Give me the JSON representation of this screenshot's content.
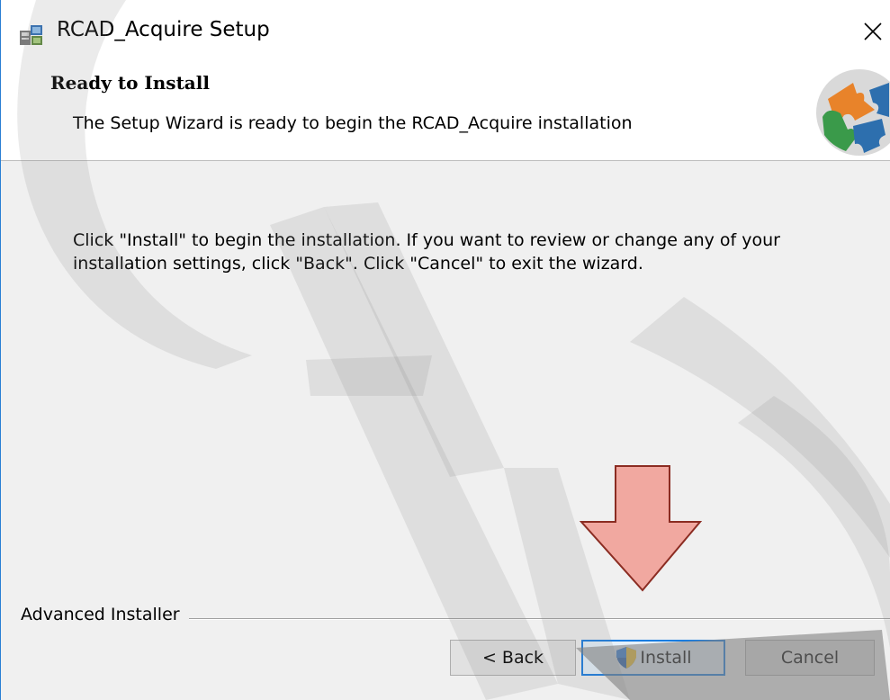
{
  "window": {
    "title": "RCAD_Acquire Setup",
    "close_glyph": "✕",
    "icons": {
      "app": "installer-box-icon",
      "close": "close-icon"
    }
  },
  "header": {
    "title": "Ready to Install",
    "subtitle": "The Setup Wizard is ready to begin the RCAD_Acquire installation",
    "logo_icon": "puzzle-pieces-icon"
  },
  "body": {
    "line1": "Click \"Install\" to begin the installation.  If you want to review or change any of your",
    "line2": "installation settings, click \"Back\".  Click \"Cancel\" to exit the wizard."
  },
  "footer": {
    "brand": "Advanced Installer",
    "buttons": {
      "back": "< Back",
      "install": "Install",
      "cancel": "Cancel"
    },
    "install_icon": "uac-shield-icon"
  },
  "overlay": {
    "arrow_icon": "down-arrow-icon",
    "watermark_icon": "cad-watermark",
    "colors": {
      "arrow_fill": "#f0a39b",
      "arrow_stroke": "#8b2c22",
      "watermark": "#808080"
    }
  }
}
